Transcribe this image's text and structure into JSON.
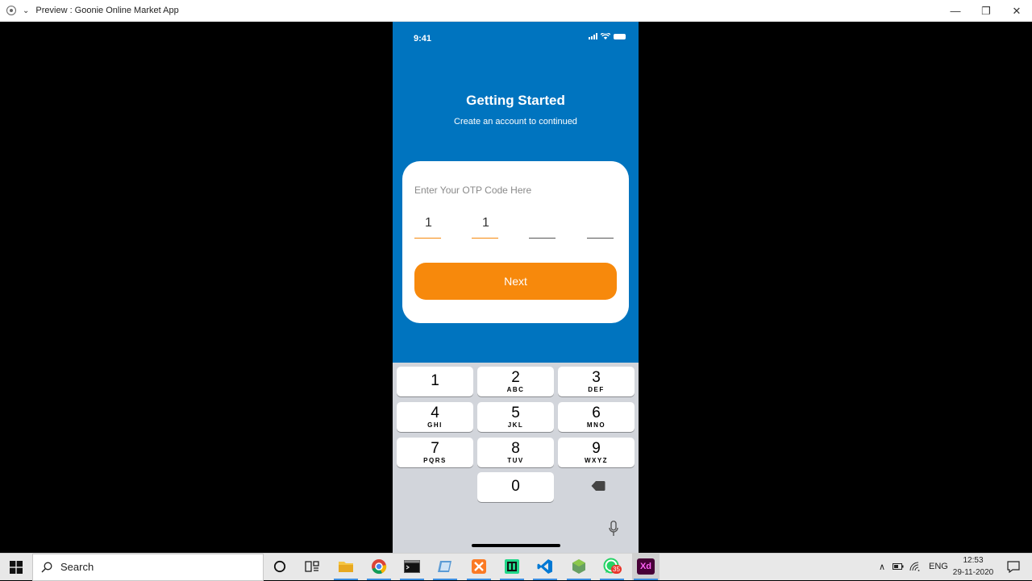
{
  "window": {
    "title": "Preview : Goonie Online Market App",
    "minimize": "—",
    "restore": "❐",
    "close": "✕"
  },
  "phone": {
    "status_time": "9:41",
    "heading": "Getting Started",
    "subheading": "Create an account to continued",
    "otp_label": "Enter Your OTP Code Here",
    "otp_digits": [
      "1",
      "1",
      "",
      ""
    ],
    "next_button": "Next"
  },
  "keypad": {
    "keys": [
      {
        "num": "1",
        "letters": ""
      },
      {
        "num": "2",
        "letters": "ABC"
      },
      {
        "num": "3",
        "letters": "DEF"
      },
      {
        "num": "4",
        "letters": "GHI"
      },
      {
        "num": "5",
        "letters": "JKL"
      },
      {
        "num": "6",
        "letters": "MNO"
      },
      {
        "num": "7",
        "letters": "PQRS"
      },
      {
        "num": "8",
        "letters": "TUV"
      },
      {
        "num": "9",
        "letters": "WXYZ"
      },
      {
        "num": "0",
        "letters": ""
      }
    ]
  },
  "taskbar": {
    "search_label": "Search",
    "whatsapp_badge": "35",
    "xd_label": "Xd",
    "language": "ENG",
    "time": "12:53",
    "date": "29-11-2020"
  },
  "colors": {
    "primary_blue": "#0074BF",
    "accent_orange": "#F7890C",
    "keypad_bg": "#D2D5DB"
  }
}
